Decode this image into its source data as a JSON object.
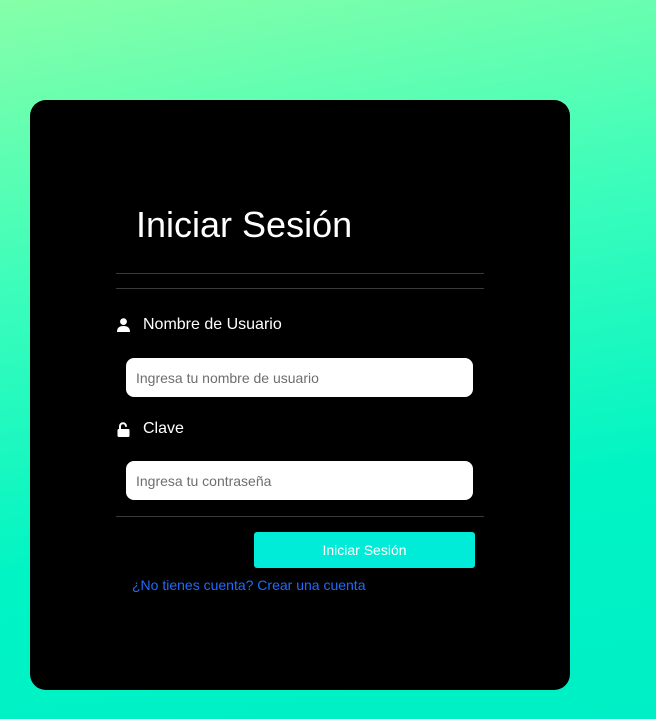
{
  "login": {
    "title": "Iniciar Sesión",
    "username": {
      "label": "Nombre de Usuario",
      "icon": "user-icon",
      "placeholder": "Ingresa tu nombre de usuario",
      "value": ""
    },
    "password": {
      "label": "Clave",
      "icon": "unlock-icon",
      "placeholder": "Ingresa tu contraseña",
      "value": ""
    },
    "submit_label": "Iniciar Sesión",
    "signup_link": "¿No tienes cuenta? Crear una cuenta"
  },
  "colors": {
    "background_gradient": [
      "#86ffa8",
      "#00efc6"
    ],
    "card": "#000000",
    "button": "#00ecd8",
    "link": "#1f6bff"
  }
}
